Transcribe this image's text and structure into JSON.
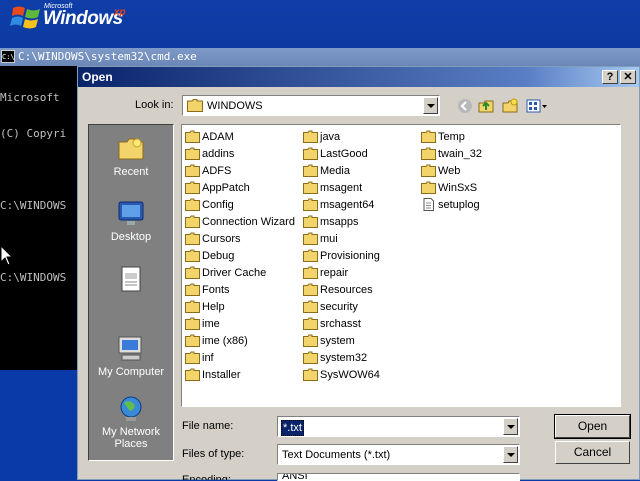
{
  "header": {
    "ms": "Microsoft",
    "windows": "Windows",
    "xp": "xp"
  },
  "cmd": {
    "title": "C:\\WINDOWS\\system32\\cmd.exe",
    "icon_text": "C:\\",
    "lines": [
      "Microsoft",
      "(C) Copyri",
      "",
      "C:\\WINDOWS",
      "",
      "C:\\WINDOWS"
    ]
  },
  "dialog": {
    "title": "Open",
    "help_label": "?",
    "close_label": "✕",
    "look_in_label": "Look in:",
    "look_in_value": "WINDOWS",
    "places": [
      {
        "label": "Recent",
        "icon": "folder-star-icon"
      },
      {
        "label": "Desktop",
        "icon": "desktop-icon"
      },
      {
        "label": "",
        "icon": "document-icon"
      },
      {
        "label": "My Computer",
        "icon": "computer-icon"
      },
      {
        "label": "My Network Places",
        "icon": "network-icon"
      }
    ],
    "files": {
      "col1": [
        "ADAM",
        "addins",
        "ADFS",
        "AppPatch",
        "Config",
        "Connection Wizard",
        "Cursors",
        "Debug",
        "Driver Cache",
        "Fonts",
        "Help",
        "ime",
        "ime (x86)",
        "inf",
        "Installer"
      ],
      "col2": [
        "java",
        "LastGood",
        "Media",
        "msagent",
        "msagent64",
        "msapps",
        "mui",
        "Provisioning",
        "repair",
        "Resources",
        "security",
        "srchasst",
        "system",
        "system32",
        "SysWOW64"
      ],
      "col3": [
        "Temp",
        "twain_32",
        "Web",
        "WinSxS",
        "setuplog"
      ]
    },
    "file_name_label": "File name:",
    "file_name_value": "*.txt",
    "files_of_type_label": "Files of type:",
    "files_of_type_value": "Text Documents (*.txt)",
    "encoding_label": "Encoding:",
    "encoding_value": "ANSI",
    "open_button": "Open",
    "cancel_button": "Cancel"
  },
  "colors": {
    "xp_blue": "#0a3aa8",
    "dialog_bg": "#d4d0c8",
    "title_blue": "#0a246a",
    "folder": "#f2d46b"
  }
}
